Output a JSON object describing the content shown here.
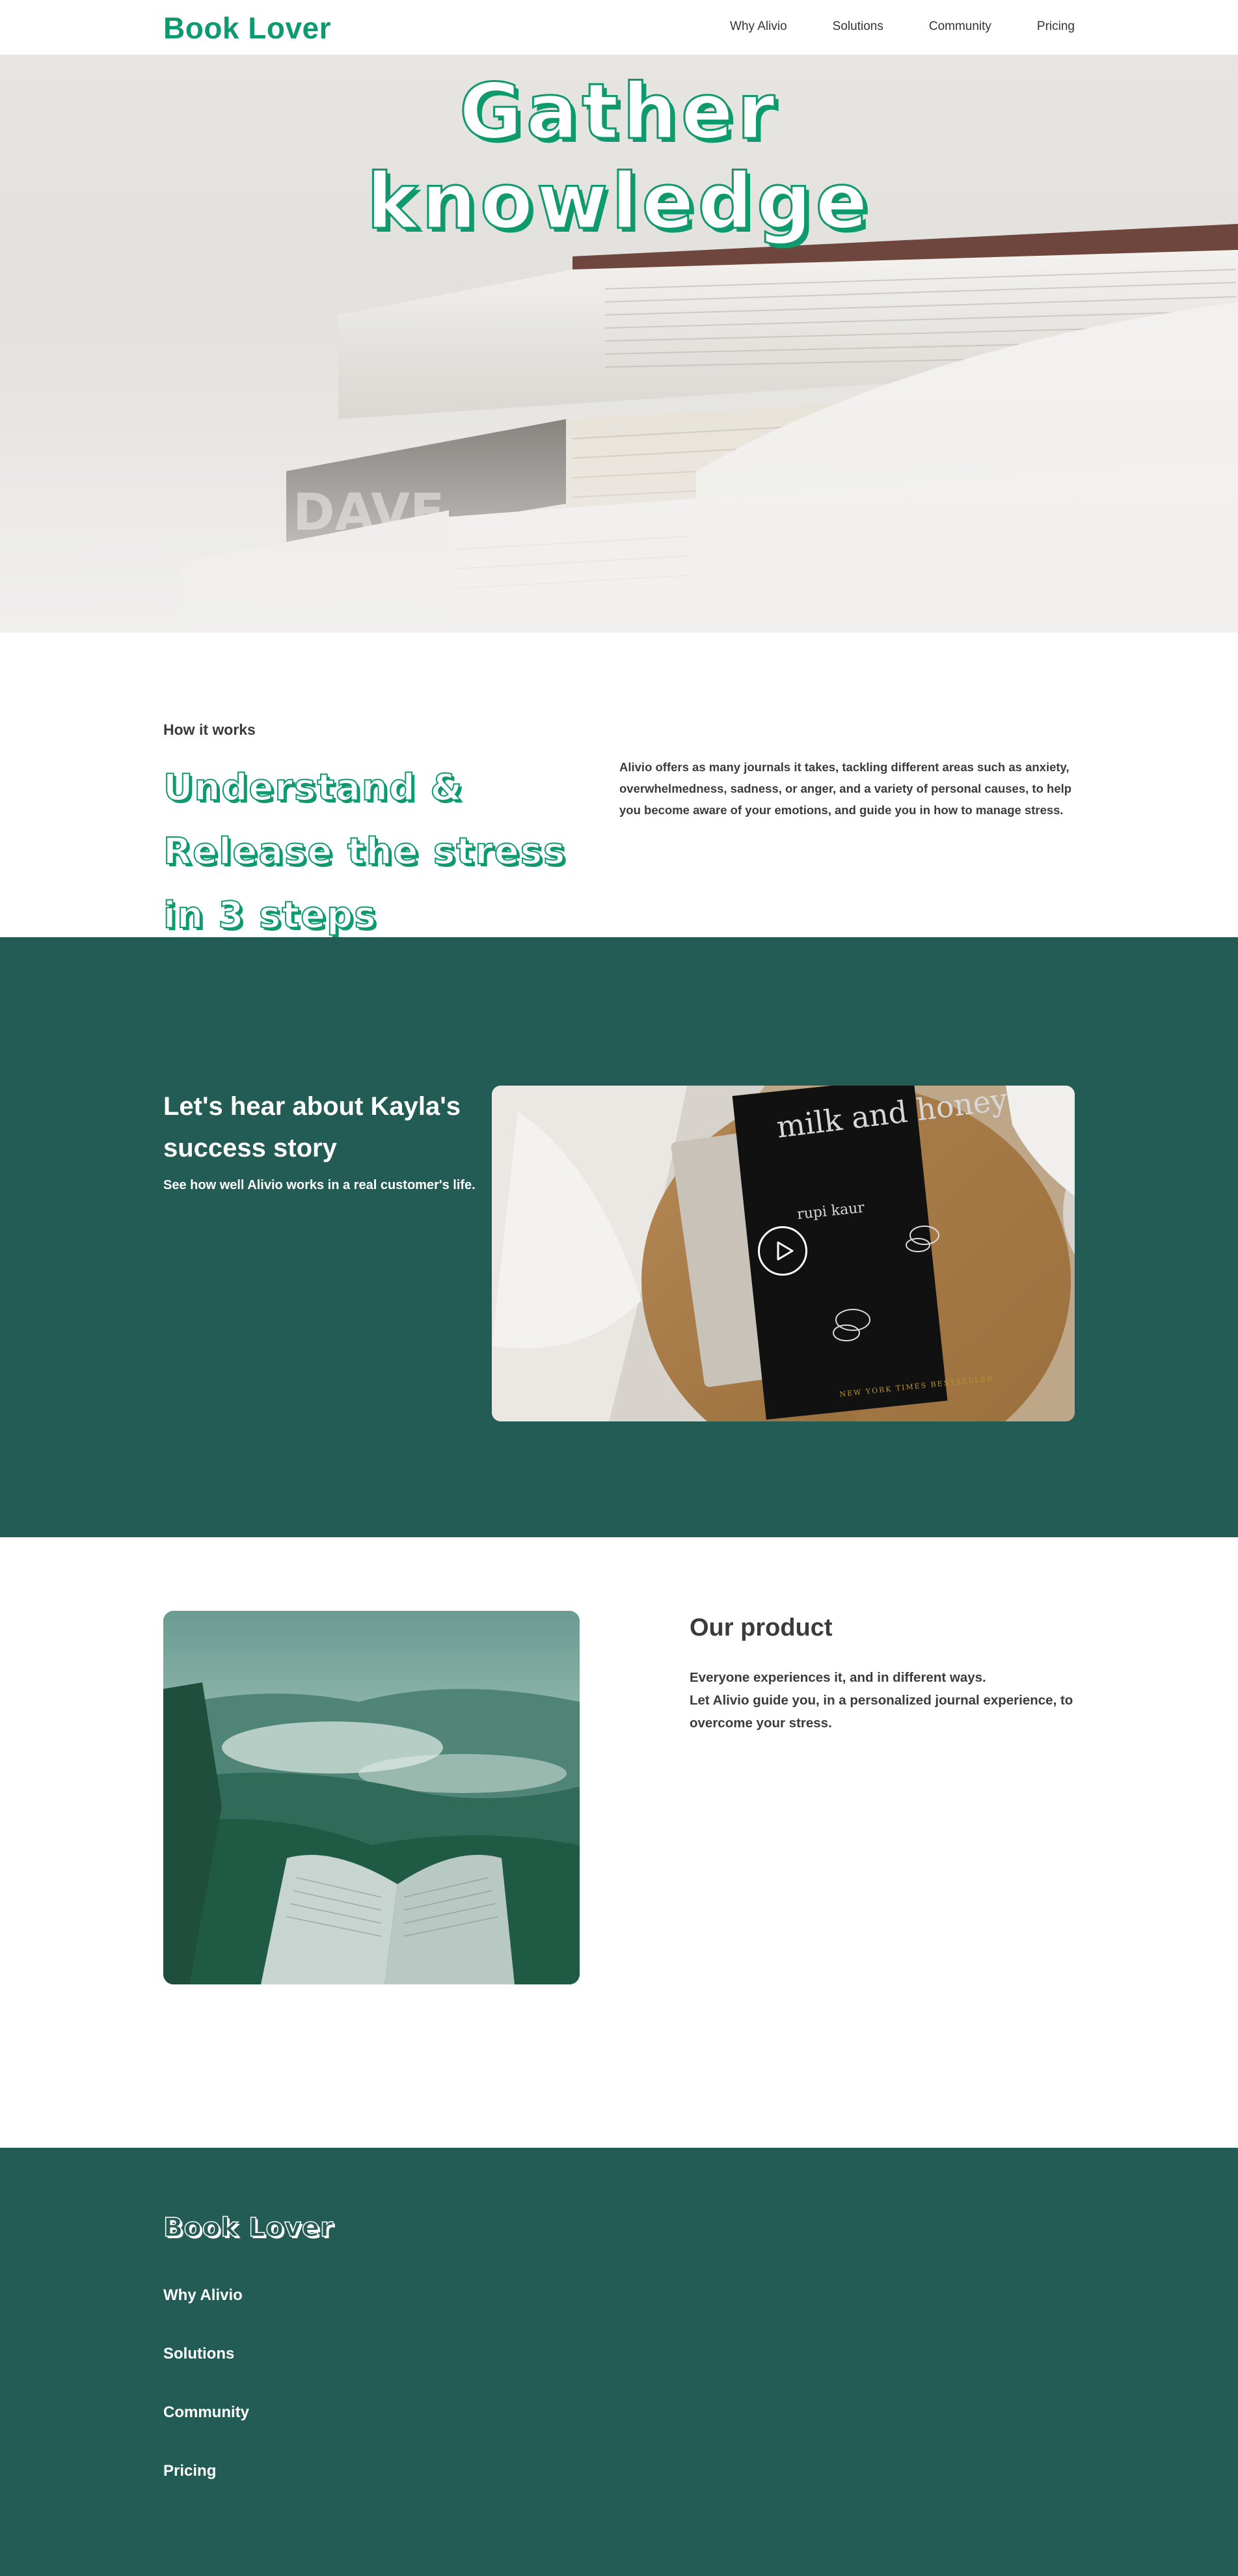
{
  "header": {
    "logo": "Book Lover",
    "nav": [
      "Why Alivio",
      "Solutions",
      "Community",
      "Pricing"
    ]
  },
  "hero": {
    "title_line1": "Gather",
    "title_line2": "knowledge"
  },
  "how": {
    "label": "How it works",
    "title": "Understand & Release the stress in 3 steps",
    "description": "Alivio offers as many journals it takes, tackling different areas such as anxiety, overwhelmedness, sadness, or anger, and a variety of personal causes, to help you become aware of your emotions, and guide you in how to manage stress."
  },
  "story": {
    "title": "Let's hear about Kayla's success story",
    "subtitle": "See how well Alivio works in a real customer's life.",
    "book_title": "milk and honey",
    "book_author": "rupi kaur",
    "book_badge": "NEW YORK TIMES BESTSELLER"
  },
  "product": {
    "title": "Our product",
    "line1": "Everyone experiences it, and in different ways.",
    "line2": "Let Alivio guide you, in a personalized journal experience, to overcome your stress."
  },
  "footer": {
    "logo": "Book Lover",
    "links": [
      "Why Alivio",
      "Solutions",
      "Community",
      "Pricing"
    ]
  },
  "colors": {
    "brand_green": "#0f9a6e",
    "dark_teal": "#235b55",
    "text": "#3b3b3b"
  }
}
